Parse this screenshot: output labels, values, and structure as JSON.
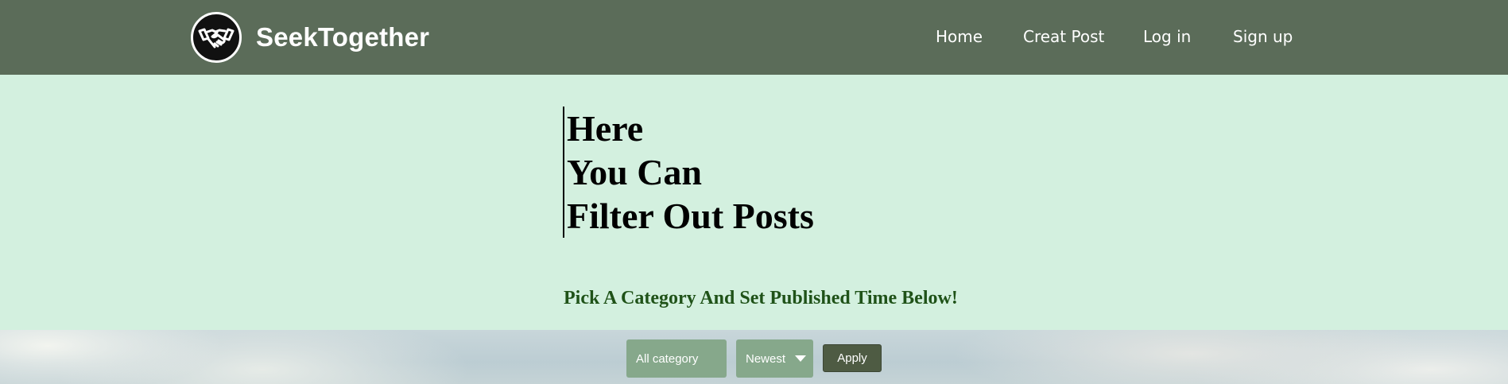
{
  "header": {
    "brand": "SeekTogether",
    "logo_icon": "handshake-icon",
    "nav": [
      "Home",
      "Creat Post",
      "Log in",
      "Sign up"
    ]
  },
  "hero": {
    "lines": [
      "Here",
      "You Can",
      "Filter Out Posts"
    ],
    "subtitle": "Pick A Category And Set Published Time Below!"
  },
  "filters": {
    "category_value": "All category",
    "time_value": "Newest",
    "apply_label": "Apply"
  },
  "colors": {
    "navbar": "#5b6c59",
    "hero_bg": "#d3f0df",
    "subtitle": "#1f5218",
    "select_bg": "#86a88b",
    "apply_bg": "#4e5b43"
  }
}
